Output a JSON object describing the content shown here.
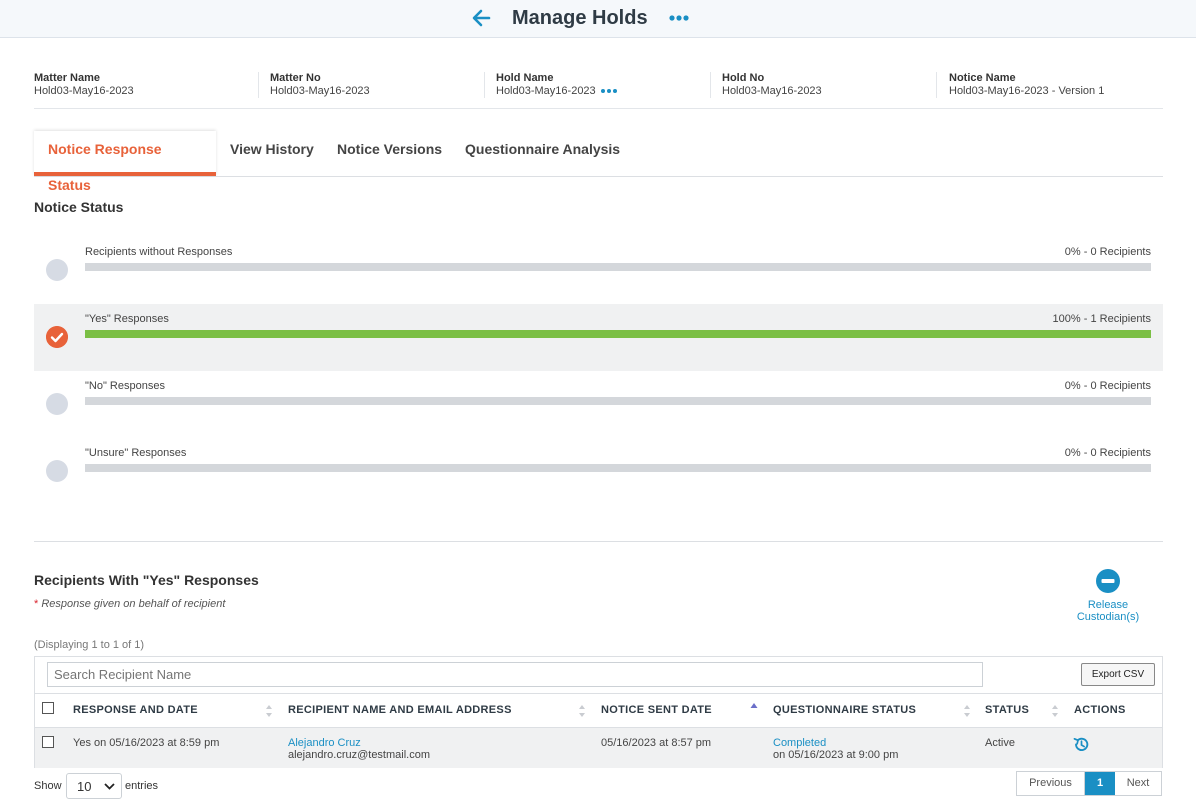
{
  "header": {
    "title": "Manage Holds"
  },
  "meta": [
    {
      "label": "Matter Name",
      "value": "Hold03-May16-2023"
    },
    {
      "label": "Matter No",
      "value": "Hold03-May16-2023"
    },
    {
      "label": "Hold Name",
      "value": "Hold03-May16-2023"
    },
    {
      "label": "Hold No",
      "value": "Hold03-May16-2023"
    },
    {
      "label": "Notice Name",
      "value": "Hold03-May16-2023 - Version 1"
    }
  ],
  "tabs": [
    {
      "label": "Notice Response Status",
      "active": true
    },
    {
      "label": "View History",
      "active": false
    },
    {
      "label": "Notice Versions",
      "active": false
    },
    {
      "label": "Questionnaire Analysis",
      "active": false
    }
  ],
  "notice_status": {
    "title": "Notice Status",
    "rows": [
      {
        "label": "Recipients without Responses",
        "value": "0% - 0 Recipients",
        "percent": 0,
        "selected": false
      },
      {
        "label": "\"Yes\" Responses",
        "value": "100% - 1 Recipients",
        "percent": 100,
        "selected": true
      },
      {
        "label": "\"No\" Responses",
        "value": "0% - 0 Recipients",
        "percent": 0,
        "selected": false
      },
      {
        "label": "\"Unsure\" Responses",
        "value": "0% - 0 Recipients",
        "percent": 0,
        "selected": false
      }
    ]
  },
  "recipients": {
    "title": "Recipients With \"Yes\" Responses",
    "note_star": "*",
    "note": "Response given on behalf of recipient",
    "release_label": "Release Custodian(s)",
    "displaying": "(Displaying 1 to 1 of 1)",
    "search_placeholder": "Search Recipient Name",
    "export_label": "Export CSV",
    "columns": [
      "RESPONSE AND DATE",
      "RECIPIENT NAME AND EMAIL ADDRESS",
      "NOTICE SENT DATE",
      "QUESTIONNAIRE STATUS",
      "STATUS",
      "ACTIONS"
    ],
    "rows": [
      {
        "response": "Yes on 05/16/2023 at 8:59 pm",
        "name": "Alejandro Cruz",
        "email": "alejandro.cruz@testmail.com",
        "sent": "05/16/2023 at 8:57 pm",
        "q_status": "Completed",
        "q_date": "on 05/16/2023 at 9:00 pm",
        "status": "Active"
      }
    ]
  },
  "footer": {
    "show_label": "Show",
    "page_size": "10",
    "entries_label": "entries",
    "previous": "Previous",
    "page": "1",
    "next": "Next"
  },
  "colors": {
    "accent": "#e8623a",
    "link": "#1a8fc4",
    "success": "#7bbf45"
  }
}
